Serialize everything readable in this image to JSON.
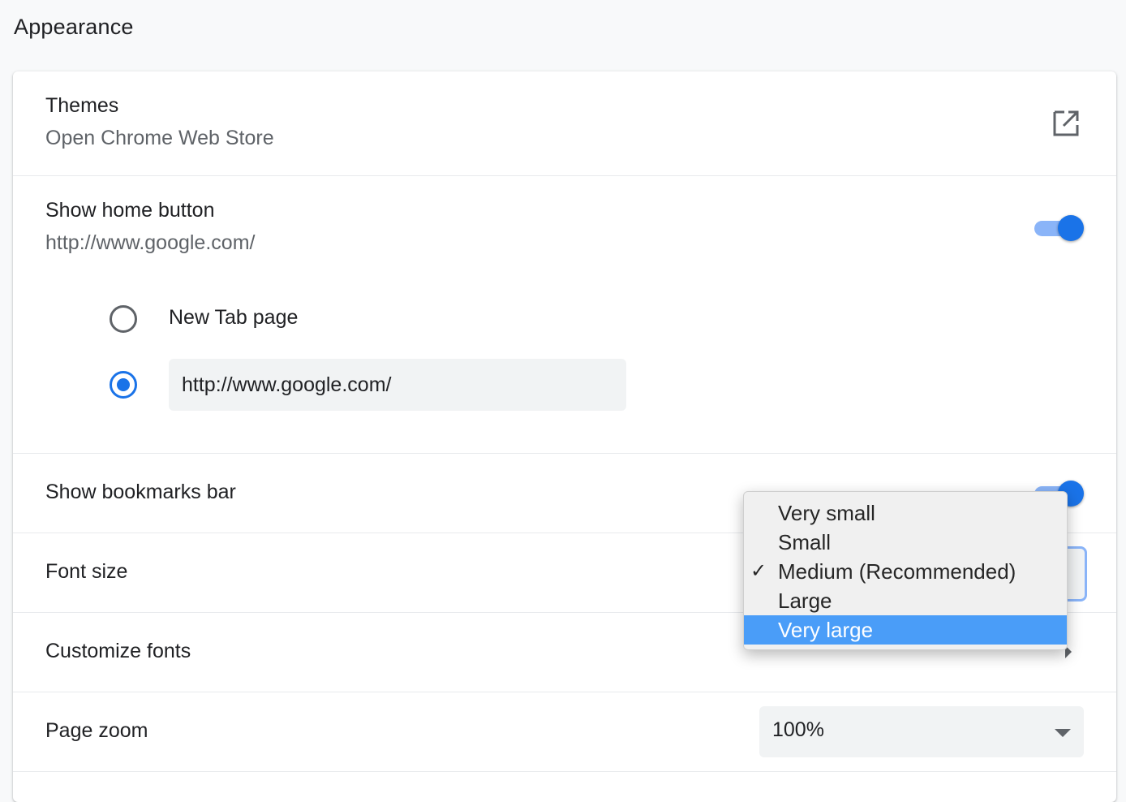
{
  "section": {
    "title": "Appearance"
  },
  "themes": {
    "label": "Themes",
    "sublabel": "Open Chrome Web Store",
    "icon": "external-link-icon"
  },
  "home_button": {
    "label": "Show home button",
    "sublabel": "http://www.google.com/",
    "toggle_on": true,
    "options": {
      "new_tab_label": "New Tab page",
      "custom_url_value": "http://www.google.com/",
      "selected": "custom_url"
    }
  },
  "bookmarks_bar": {
    "label": "Show bookmarks bar",
    "toggle_on": true
  },
  "font_size": {
    "label": "Font size",
    "options": [
      "Very small",
      "Small",
      "Medium (Recommended)",
      "Large",
      "Very large"
    ],
    "selected": "Medium (Recommended)",
    "highlighted": "Very large"
  },
  "customize_fonts": {
    "label": "Customize fonts"
  },
  "page_zoom": {
    "label": "Page zoom",
    "value": "100%"
  },
  "colors": {
    "accent": "#1a73e8",
    "toggle_track": "#8ab4f8",
    "menu_highlight": "#4a9df8"
  }
}
